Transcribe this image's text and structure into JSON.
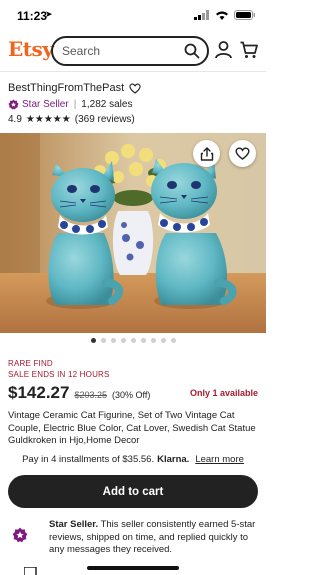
{
  "status": {
    "time": "11:23",
    "location_arrow": "➤"
  },
  "header": {
    "logo": "Etsy",
    "search_placeholder": "Search"
  },
  "shop": {
    "name": "BestThingFromThePast",
    "star_seller": "Star Seller",
    "sales": "1,282 sales",
    "rating": "4.9",
    "stars": "★★★★★",
    "reviews": "(369 reviews)"
  },
  "gallery": {
    "image_count": 9,
    "current_index": 1
  },
  "listing": {
    "rare_find": "RARE FIND",
    "sale_ends": "SALE ENDS IN 12 HOURS",
    "price": "$142.27",
    "original_price": "$203.25",
    "discount": "(30% Off)",
    "availability": "Only 1 available",
    "title": "Vintage Ceramic Cat Figurine, Set of Two Vintage Cat Couple, Electric Blue Color, Cat Lover, Swedish Cat Statue Guldkroken in Hjo,Home Decor"
  },
  "installments": {
    "text": "Pay in 4 installments of $35.56.",
    "provider": "Klarna.",
    "learn_more": "Learn more"
  },
  "actions": {
    "add_to_cart": "Add to cart"
  },
  "star_seller_info": {
    "heading": "Star Seller.",
    "body": " This seller consistently earned 5-star reviews, shipped on time, and replied quickly to any messages they received."
  },
  "colors": {
    "brand": "#f1641e",
    "sale": "#a61a2e",
    "star_seller": "#7f187f",
    "cat": "#5fb8c4"
  }
}
